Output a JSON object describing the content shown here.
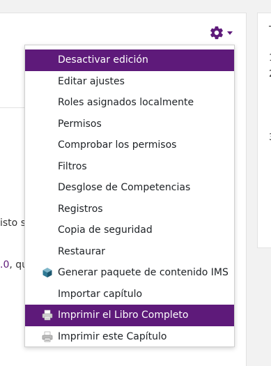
{
  "background": {
    "text_line1": "isto s",
    "text_line2_link": ".0",
    "text_line2_rest": ", qu"
  },
  "side": {
    "numbers": [
      "1",
      "2",
      "3"
    ],
    "top_char": "T"
  },
  "menu": {
    "items": [
      {
        "label": "Desactivar edición",
        "active": true,
        "icon": ""
      },
      {
        "label": "Editar ajustes",
        "active": false,
        "icon": ""
      },
      {
        "label": "Roles asignados localmente",
        "active": false,
        "icon": ""
      },
      {
        "label": "Permisos",
        "active": false,
        "icon": ""
      },
      {
        "label": "Comprobar los permisos",
        "active": false,
        "icon": ""
      },
      {
        "label": "Filtros",
        "active": false,
        "icon": ""
      },
      {
        "label": "Desglose de Competencias",
        "active": false,
        "icon": ""
      },
      {
        "label": "Registros",
        "active": false,
        "icon": ""
      },
      {
        "label": "Copia de seguridad",
        "active": false,
        "icon": ""
      },
      {
        "label": "Restaurar",
        "active": false,
        "icon": ""
      },
      {
        "label": "Generar paquete de contenido IMS",
        "active": false,
        "icon": "ims-package-icon"
      },
      {
        "label": "Importar capítulo",
        "active": false,
        "icon": ""
      },
      {
        "label": "Imprimir el Libro Completo",
        "active": true,
        "icon": "print-book-icon"
      },
      {
        "label": "Imprimir este Capítulo",
        "active": false,
        "icon": "print-chapter-icon"
      }
    ]
  },
  "colors": {
    "accent": "#5e1a7a",
    "menu_text": "#1d2125",
    "active_text": "#ffffff"
  }
}
